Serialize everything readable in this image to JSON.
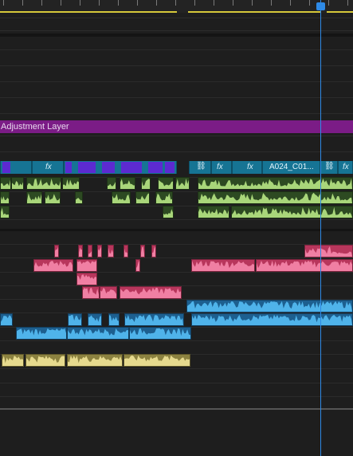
{
  "timeline": {
    "adjustment_layer_label": "Adjustment Layer",
    "clip_name": "A024_C01...",
    "fx_label": "fx",
    "transition_icon": "transition-icon",
    "playhead_icon": "playhead-marker-icon"
  },
  "colors": {
    "background": "#1e1e1e",
    "adjustment_layer": "#7b1c86",
    "video_clip": "#167494",
    "green_audio": "#3d5a2a",
    "pink_audio": "#e0507a",
    "blue_audio": "#2a8fd0",
    "yellow_audio": "#e0d48a",
    "playhead": "#2e8ae6",
    "work_area": "#d6c83a"
  }
}
